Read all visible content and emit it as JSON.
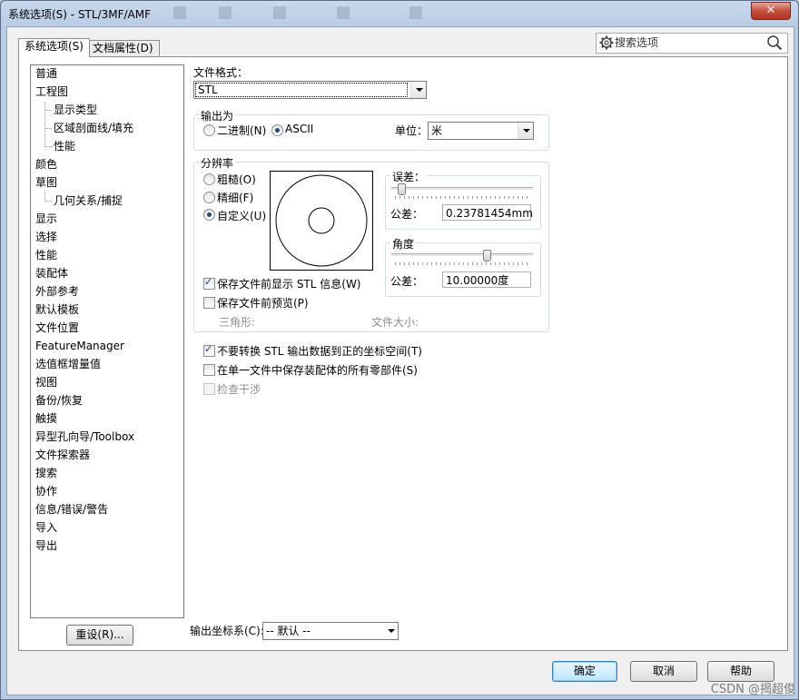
{
  "window": {
    "title": "系统选项(S) - STL/3MF/AMF",
    "close_glyph": "✕"
  },
  "tabs": [
    {
      "label": "系统选项(S)",
      "active": true
    },
    {
      "label": "文档属性(D)",
      "active": false
    }
  ],
  "search": {
    "placeholder": "搜索选项"
  },
  "tree": {
    "items": [
      {
        "label": "普通",
        "level": 0
      },
      {
        "label": "工程图",
        "level": 0
      },
      {
        "label": "显示类型",
        "level": 1
      },
      {
        "label": "区域剖面线/填充",
        "level": 1
      },
      {
        "label": "性能",
        "level": 1
      },
      {
        "label": "颜色",
        "level": 0
      },
      {
        "label": "草图",
        "level": 0
      },
      {
        "label": "几何关系/捕捉",
        "level": 1
      },
      {
        "label": "显示",
        "level": 0
      },
      {
        "label": "选择",
        "level": 0
      },
      {
        "label": "性能",
        "level": 0
      },
      {
        "label": "装配体",
        "level": 0
      },
      {
        "label": "外部参考",
        "level": 0
      },
      {
        "label": "默认模板",
        "level": 0
      },
      {
        "label": "文件位置",
        "level": 0
      },
      {
        "label": "FeatureManager",
        "level": 0
      },
      {
        "label": "选值框增量值",
        "level": 0
      },
      {
        "label": "视图",
        "level": 0
      },
      {
        "label": "备份/恢复",
        "level": 0
      },
      {
        "label": "触摸",
        "level": 0
      },
      {
        "label": "异型孔向导/Toolbox",
        "level": 0
      },
      {
        "label": "文件探索器",
        "level": 0
      },
      {
        "label": "搜索",
        "level": 0
      },
      {
        "label": "协作",
        "level": 0
      },
      {
        "label": "信息/错误/警告",
        "level": 0
      },
      {
        "label": "导入",
        "level": 0
      },
      {
        "label": "导出",
        "level": 0
      }
    ]
  },
  "reset_button": "重设(R)...",
  "file_format": {
    "label": "文件格式：",
    "value": "STL"
  },
  "output_as": {
    "group_label": "输出为",
    "binary_label": "二进制(N)",
    "ascii_label": "ASCII",
    "selected": "ASCII",
    "unit_label": "单位：",
    "unit_value": "米"
  },
  "resolution": {
    "group_label": "分辨率",
    "options": [
      "粗糙(O)",
      "精细(F)",
      "自定义(U)"
    ],
    "selected": "自定义(U)",
    "deviation": {
      "group_label": "误差：",
      "field_label": "公差：",
      "value": "0.23781454mm",
      "slider_fraction": 0.05
    },
    "angle": {
      "group_label": "角度",
      "field_label": "公差：",
      "value": "10.00000度",
      "slider_fraction": 0.67
    },
    "show_stl_info": {
      "label": "保存文件前显示 STL 信息(W)",
      "checked": true
    },
    "preview": {
      "label": "保存文件前预览(P)",
      "checked": false
    },
    "triangles_label": "三角形:",
    "file_size_label": "文件大小:"
  },
  "options": [
    {
      "label": "不要转换 STL 输出数据到正的坐标空间(T)",
      "checked": true,
      "enabled": true
    },
    {
      "label": "在单一文件中保存装配体的所有零部件(S)",
      "checked": false,
      "enabled": true
    },
    {
      "label": "检查干涉",
      "checked": false,
      "enabled": false
    }
  ],
  "output_coord": {
    "label": "输出坐标系(C):",
    "value": "-- 默认 --"
  },
  "footer": {
    "ok": "确定",
    "cancel": "取消",
    "help": "帮助"
  },
  "watermark": "CSDN @揭超俊"
}
